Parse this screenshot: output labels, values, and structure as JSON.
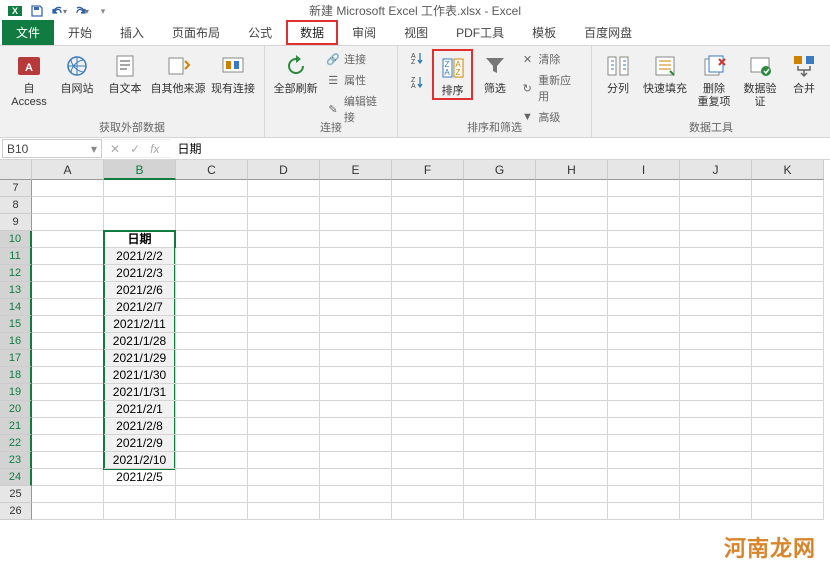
{
  "app": {
    "title": "新建 Microsoft Excel 工作表.xlsx - Excel"
  },
  "qat": {
    "save": "保存",
    "undo": "撤销",
    "redo": "重做"
  },
  "tabs": {
    "file": "文件",
    "home": "开始",
    "insert": "插入",
    "pagelayout": "页面布局",
    "formulas": "公式",
    "data": "数据",
    "review": "审阅",
    "view": "视图",
    "pdf": "PDF工具",
    "template": "模板",
    "baidu": "百度网盘"
  },
  "ribbon": {
    "g1": {
      "label": "获取外部数据",
      "access": "自 Access",
      "web": "自网站",
      "text": "自文本",
      "other": "自其他来源",
      "existing": "现有连接"
    },
    "g2": {
      "label": "连接",
      "refresh": "全部刷新",
      "conn": "连接",
      "prop": "属性",
      "editlink": "编辑链接"
    },
    "g3": {
      "label": "排序和筛选",
      "sort": "排序",
      "filter": "筛选",
      "clear": "清除",
      "reapply": "重新应用",
      "advanced": "高级"
    },
    "g4": {
      "label": "数据工具",
      "t2c": "分列",
      "flash": "快速填充",
      "dup": "删除\n重复项",
      "valid": "数据验\n证",
      "consol": "合并"
    }
  },
  "formula": {
    "cellref": "B10",
    "value": "日期"
  },
  "grid": {
    "cols": [
      "A",
      "B",
      "C",
      "D",
      "E",
      "F",
      "G",
      "H",
      "I",
      "J",
      "K"
    ],
    "startRow": 7,
    "rows": [
      {
        "r": 7,
        "b": ""
      },
      {
        "r": 8,
        "b": ""
      },
      {
        "r": 9,
        "b": ""
      },
      {
        "r": 10,
        "b": "日期"
      },
      {
        "r": 11,
        "b": "2021/2/2"
      },
      {
        "r": 12,
        "b": "2021/2/3"
      },
      {
        "r": 13,
        "b": "2021/2/6"
      },
      {
        "r": 14,
        "b": "2021/2/7"
      },
      {
        "r": 15,
        "b": "2021/2/11"
      },
      {
        "r": 16,
        "b": "2021/1/28"
      },
      {
        "r": 17,
        "b": "2021/1/29"
      },
      {
        "r": 18,
        "b": "2021/1/30"
      },
      {
        "r": 19,
        "b": "2021/1/31"
      },
      {
        "r": 20,
        "b": "2021/2/1"
      },
      {
        "r": 21,
        "b": "2021/2/8"
      },
      {
        "r": 22,
        "b": "2021/2/9"
      },
      {
        "r": 23,
        "b": "2021/2/10"
      },
      {
        "r": 24,
        "b": "2021/2/5"
      },
      {
        "r": 25,
        "b": ""
      },
      {
        "r": 26,
        "b": ""
      }
    ]
  },
  "watermark": "河南龙网"
}
